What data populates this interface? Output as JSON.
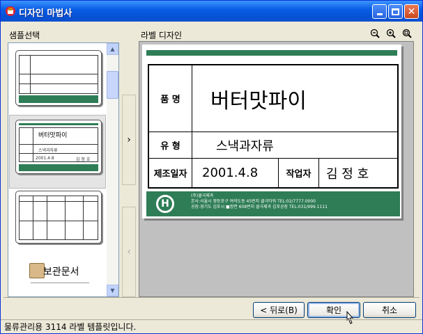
{
  "window": {
    "title": "디자인 마법사"
  },
  "left": {
    "title": "샘플선택"
  },
  "right": {
    "title": "라벨 디자인"
  },
  "label": {
    "product_name_label": "품 명",
    "product_name_value": "버터맛파이",
    "type_label": "유 형",
    "type_value": "스낵과자류",
    "date_label": "제조일자",
    "date_value": "2001.4.8",
    "worker_label": "작업자",
    "worker_value": "김 정 호",
    "footer_logo": "H",
    "footer_line1": "(주)클극제과",
    "footer_line2": "본사:서울시 영등포구 여의도동 45번지 클극타워 TEL:02/7777.0000",
    "footer_line3": "공장:경기도 김포시 ■정면 608번지 클극제과 김포공장 TEL:031/999.1111"
  },
  "thumbs": {
    "thumb2_title": "버터맛파이",
    "thumb2_type": "스낵과자류",
    "thumb2_date": "2001.4.8",
    "thumb2_worker": "김 정 호",
    "thumb4_title": "보관문서"
  },
  "buttons": {
    "back": "< 뒤로(B)",
    "ok": "확인",
    "cancel": "취소"
  },
  "status": {
    "text": "물류관리용 3114 라벨 템플릿입니다."
  },
  "colors": {
    "accent_green": "#2e7d56",
    "title_blue": "#0553d8"
  }
}
